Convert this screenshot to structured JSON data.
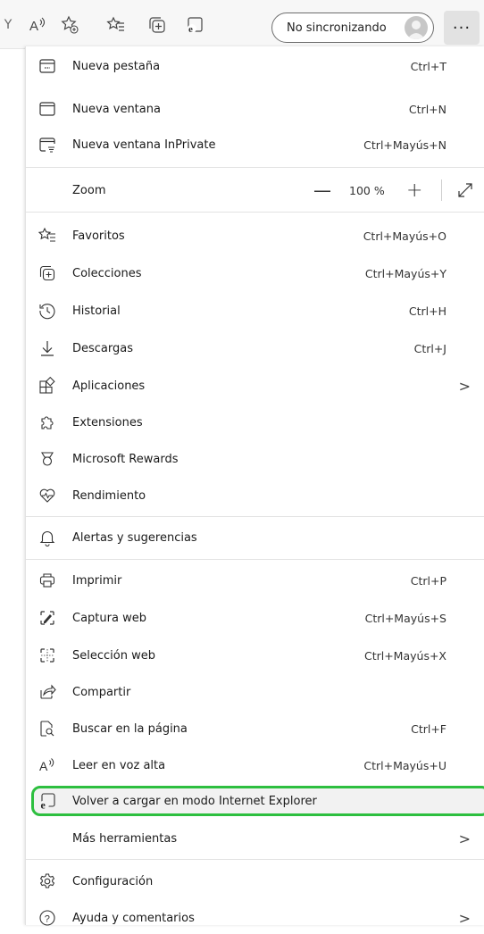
{
  "toolbar": {
    "sync_label": "No sincronizando",
    "more_label": "···",
    "cut_letter": "Y"
  },
  "menu": {
    "items": [
      {
        "label": "Nueva pestaña",
        "shortcut": "Ctrl+T",
        "icon": "new-tab-icon"
      },
      {
        "label": "Nueva ventana",
        "shortcut": "Ctrl+N",
        "icon": "new-window-icon"
      },
      {
        "label": "Nueva ventana InPrivate",
        "shortcut": "Ctrl+Mayús+N",
        "icon": "inprivate-icon"
      },
      {
        "label": "Zoom",
        "zoom_minus": "—",
        "zoom_value": "100 %",
        "zoom_plus": "+"
      },
      {
        "label": "Favoritos",
        "shortcut": "Ctrl+Mayús+O",
        "icon": "favorites-icon"
      },
      {
        "label": "Colecciones",
        "shortcut": "Ctrl+Mayús+Y",
        "icon": "collections-icon"
      },
      {
        "label": "Historial",
        "shortcut": "Ctrl+H",
        "icon": "history-icon"
      },
      {
        "label": "Descargas",
        "shortcut": "Ctrl+J",
        "icon": "download-icon"
      },
      {
        "label": "Aplicaciones",
        "chevron": ">",
        "icon": "apps-icon"
      },
      {
        "label": "Extensiones",
        "icon": "extensions-icon"
      },
      {
        "label": "Microsoft Rewards",
        "icon": "rewards-icon"
      },
      {
        "label": "Rendimiento",
        "icon": "performance-icon"
      },
      {
        "label": "Alertas y sugerencias",
        "icon": "bell-icon"
      },
      {
        "label": "Imprimir",
        "shortcut": "Ctrl+P",
        "icon": "print-icon"
      },
      {
        "label": "Captura web",
        "shortcut": "Ctrl+Mayús+S",
        "icon": "web-capture-icon"
      },
      {
        "label": "Selección web",
        "shortcut": "Ctrl+Mayús+X",
        "icon": "web-select-icon"
      },
      {
        "label": "Compartir",
        "icon": "share-icon"
      },
      {
        "label": "Buscar en la página",
        "shortcut": "Ctrl+F",
        "icon": "find-icon"
      },
      {
        "label": "Leer en voz alta",
        "shortcut": "Ctrl+Mayús+U",
        "icon": "read-aloud-icon"
      },
      {
        "label": "Volver a cargar en modo Internet Explorer",
        "icon": "ie-mode-icon"
      },
      {
        "label": "Más herramientas",
        "chevron": ">"
      },
      {
        "label": "Configuración",
        "icon": "gear-icon"
      },
      {
        "label": "Ayuda y comentarios",
        "chevron": ">",
        "icon": "help-icon"
      }
    ]
  },
  "colors": {
    "highlight_border": "#2dbf3f",
    "hover_bg": "#f2f2f2"
  }
}
